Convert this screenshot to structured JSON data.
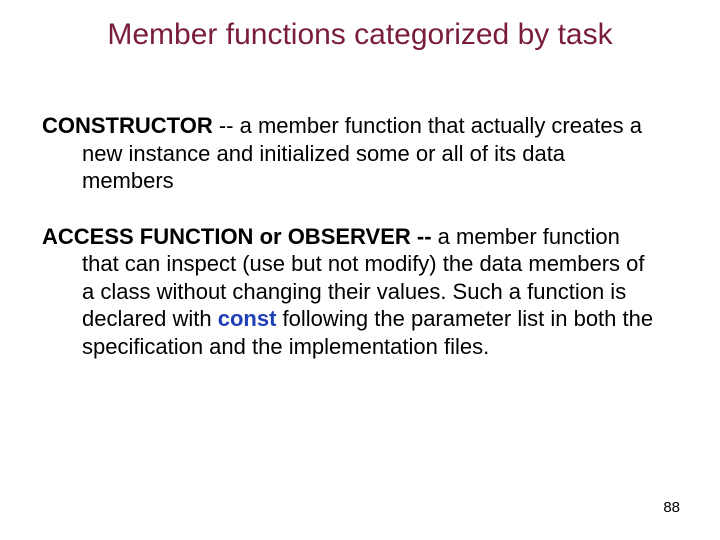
{
  "title": "Member functions categorized by task",
  "p1": {
    "term": "CONSTRUCTOR",
    "sep": " --  ",
    "rest": "a member function that actually creates a new instance and initialized some or all of its data members"
  },
  "p2": {
    "term1": "ACCESS FUNCTION",
    "or": " or ",
    "term2": "OBSERVER",
    "sep": " -- ",
    "part1": "a member function that can inspect (use but not modify) the data members of a class without changing their values.  Such a function is declared with ",
    "const": "const",
    "part2": " following the parameter list in both the specification and the implementation files."
  },
  "page_number": "88"
}
